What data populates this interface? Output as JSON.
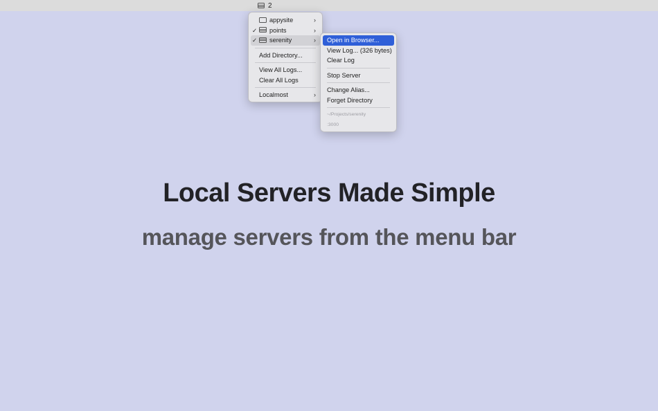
{
  "menubar": {
    "status_item": {
      "icon": "server-icon",
      "count": "2"
    }
  },
  "main_menu": {
    "items": [
      {
        "label": "appysite",
        "icon": "window-icon",
        "checked": false
      },
      {
        "label": "points",
        "icon": "server-icon",
        "checked": true
      },
      {
        "label": "serenity",
        "icon": "server-icon",
        "checked": true
      }
    ],
    "add_directory": "Add Directory...",
    "view_all_logs": "View All Logs...",
    "clear_all_logs": "Clear All Logs",
    "localmost": "Localmost",
    "check_glyph": "✓",
    "chevron_glyph": "›"
  },
  "sub_menu": {
    "open_in_browser": "Open in Browser...",
    "view_log": "View Log... (326 bytes)",
    "clear_log": "Clear Log",
    "stop_server": "Stop Server",
    "change_alias": "Change Alias...",
    "forget_directory": "Forget Directory",
    "path": "~/Projects/serenity",
    "port": ":3000"
  },
  "marketing": {
    "headline": "Local Servers Made Simple",
    "subline": "manage servers from the menu bar"
  },
  "colors": {
    "background": "#d0d3ed",
    "menubar": "#dcdcdc",
    "menu_bg": "#e7e7ea",
    "selection": "#2f5fd8",
    "headline": "#222226",
    "subline": "#55555a"
  }
}
